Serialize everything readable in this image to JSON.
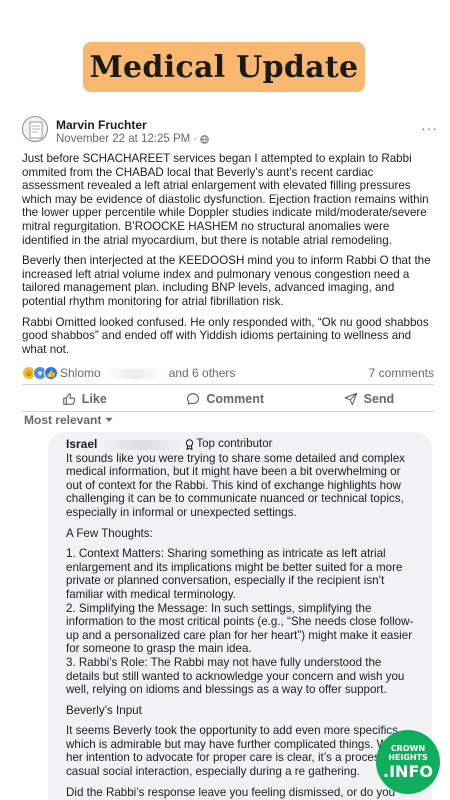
{
  "banner": {
    "title": "Medical Update"
  },
  "post": {
    "author": "Marvin Fruchter",
    "timestamp": "November 22 at 12:25 PM ·",
    "more": "···",
    "paragraphs": [
      "Just before SCHACHAREET services began I attempted to explain to Rabbi ommited from the CHABAD local that Beverly’s aunt’s recent cardiac assessment revealed a left atrial enlargement with elevated filling pressures which may be evidence of diastolic dysfunction. Ejection fraction remains within the lower upper percentile while Doppler studies indicate mild/moderate/severe mitral regurgitation. B’ROOCKE HASHEM no structural anomalies were identified in the atrial myocardium, but there is notable atrial remodeling.",
      "Beverly then interjected at the KEEDOOSH mind you to inform Rabbi O that the increased left atrial volume index and pulmonary venous congestion need a tailored management plan. including BNP levels, advanced imaging, and potential rhythm monitoring for atrial fibrillation risk.",
      "Rabbi Omitted looked confused. He only responded with, “Ok nu good shabbos good shabbos” and ended off with Yiddish idioms pertaining to wellness and what not."
    ],
    "reactions": {
      "first_name": "Shlomo",
      "others": "and 6 others",
      "comments": "7 comments"
    },
    "actions": {
      "like": "Like",
      "comment": "Comment",
      "send": "Send"
    },
    "sort_label": "Most relevant"
  },
  "comment": {
    "author": "Israel",
    "badge": "Top contributor",
    "paragraphs": [
      "It sounds like you were trying to share some detailed and complex medical information, but it might have been a bit overwhelming or out of context for the Rabbi. This kind of exchange highlights how challenging it can be to communicate nuanced or technical topics, especially in informal or unexpected settings.",
      "A Few Thoughts:",
      "1. Context Matters: Sharing something as intricate as left atrial enlargement and its implications might be better suited for a more private or planned conversation, especially if the recipient isn’t familiar with medical terminology.",
      "2. Simplifying the Message: In such settings, simplifying the information to the most critical points (e.g., “She needs close follow-up and a personalized care plan for her heart”) might make it easier for someone to grasp the main idea.",
      "3. Rabbi’s Role: The Rabbi may not have fully understood the details but still wanted to acknowledge your concern and wish you well, relying on idioms and blessings as a way to offer support.",
      "Beverly’s Input",
      "It seems Beverly took the opportunity to add even more specifics, which is admirable but may have further complicated things. While her intention to advocate for proper care is clear, it’s a process in a casual social interaction, especially during a re gathering.",
      "Did the Rabbi’s response leave you feeling dismissed, or do you"
    ]
  },
  "watermark": {
    "line1": "CROWN",
    "line2": "HEIGHTS",
    "line3": ".INFO"
  },
  "colors": {
    "banner": "#f9b76f",
    "link_blue": "#1877f2",
    "logo_green": "#0fae5a",
    "bubble": "#f0f2f5"
  }
}
